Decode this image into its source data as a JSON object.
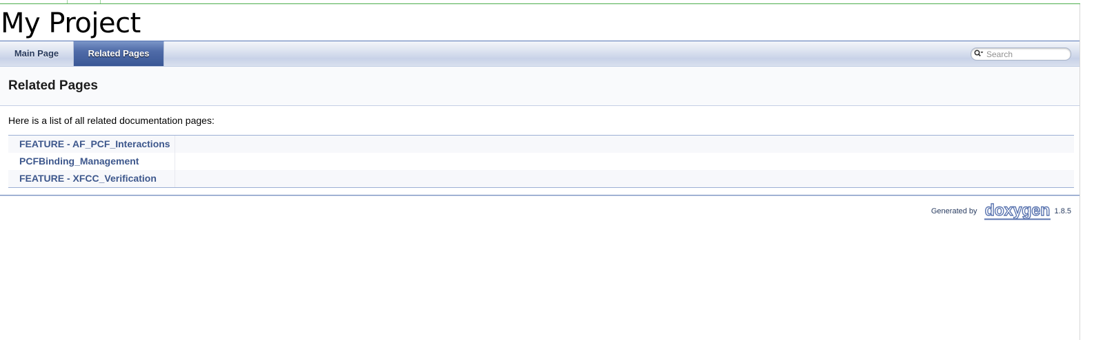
{
  "project": {
    "name": "My Project"
  },
  "navbar": {
    "tabs": [
      {
        "label": "Main Page",
        "active": false
      },
      {
        "label": "Related Pages",
        "active": true
      }
    ],
    "search": {
      "placeholder": "Search",
      "icon": "magnifier-dropdown-icon"
    }
  },
  "header": {
    "title": "Related Pages"
  },
  "content": {
    "intro": "Here is a list of all related documentation pages:",
    "pages": [
      {
        "label": "FEATURE - AF_PCF_Interactions"
      },
      {
        "label": "PCFBinding_Management"
      },
      {
        "label": "FEATURE - XFCC_Verification"
      }
    ]
  },
  "footer": {
    "generated_by": "Generated by",
    "tool": "doxygen",
    "version": "1.8.5"
  },
  "colors": {
    "link": "#3d578c",
    "active_tab": "#4f6ba8",
    "rule": "#5373b4"
  }
}
